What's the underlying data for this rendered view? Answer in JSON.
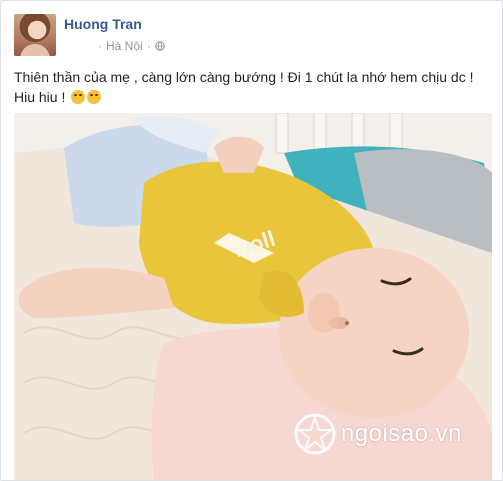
{
  "post": {
    "author": "Huong Tran",
    "location": "Hà Nội",
    "separator": "·",
    "text_line1": "Thiên thần của mẹ , càng lớn càng bướng ! Đi 1 chút la nhớ hem chịu dc !",
    "text_line2": "Hiu hiu ! "
  },
  "photo": {
    "watermark": "ngoisao.vn",
    "shirt_print": "woll"
  },
  "colors": {
    "link": "#365899",
    "meta": "#90949c",
    "text": "#1d2129"
  },
  "icons": [
    "globe-icon",
    "emoji-persevere-icon",
    "emoji-weary-icon",
    "ngoisao-logo-icon"
  ]
}
